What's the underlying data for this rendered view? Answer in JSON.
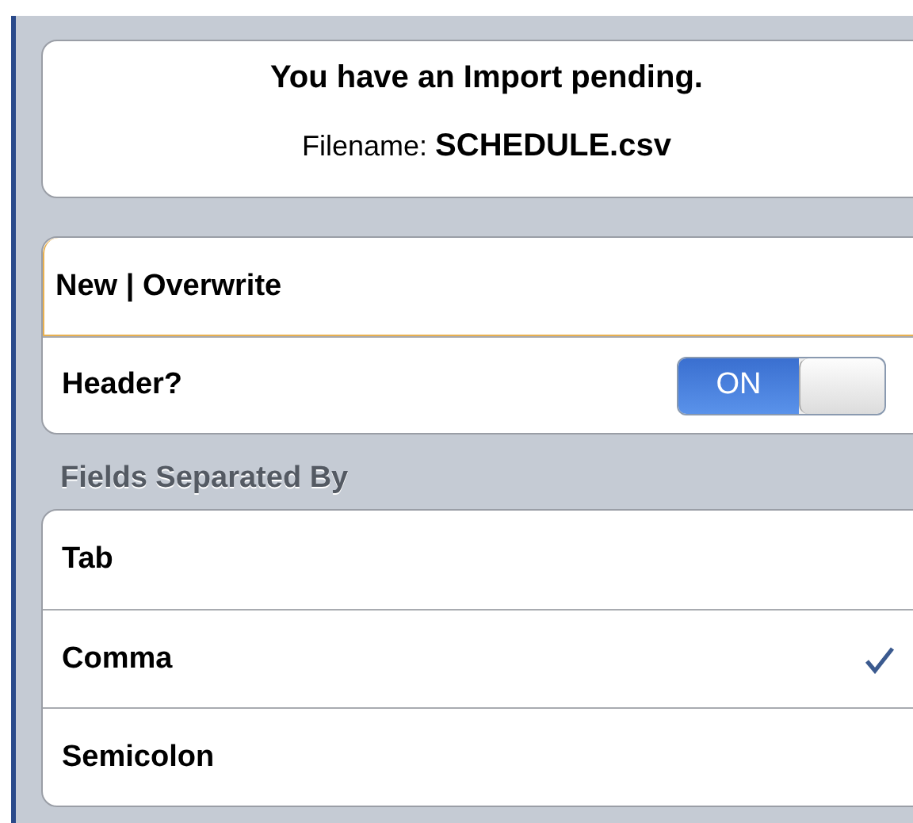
{
  "notice": {
    "title": "You have an Import pending.",
    "filename_line": "Filename: **SCHEDULE.csv**"
  },
  "settings": [
    {
      "kind": "field",
      "label": "New | Overwrite",
      "focused": true
    },
    {
      "kind": "switch",
      "label": "Header?",
      "on": true,
      "switch_text": "ON"
    }
  ],
  "separator_section": {
    "header": "Fields Separated By",
    "options": [
      {
        "label": "Tab",
        "selected": false
      },
      {
        "label": "Comma",
        "selected": true
      },
      {
        "label": "Semicolon",
        "selected": false
      }
    ]
  }
}
